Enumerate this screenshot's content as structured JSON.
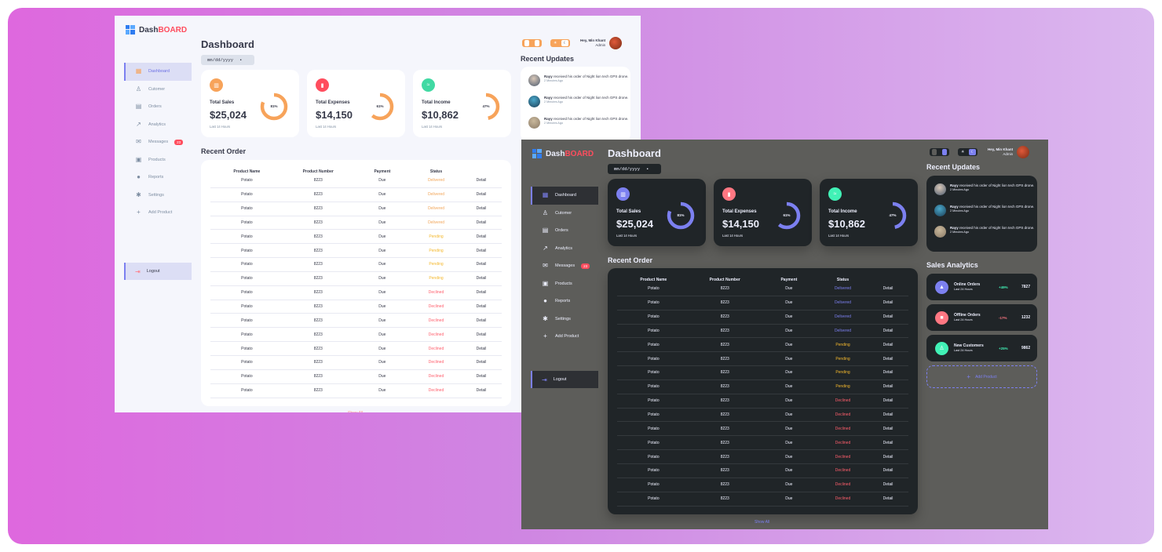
{
  "brand": {
    "part1": "Dash",
    "part2": "BOARD"
  },
  "nav": [
    {
      "label": "Dashboard",
      "icon": "grid-icon"
    },
    {
      "label": "Cutomer",
      "icon": "person-icon"
    },
    {
      "label": "Orders",
      "icon": "receipt-icon"
    },
    {
      "label": "Analytics",
      "icon": "trend-icon"
    },
    {
      "label": "Messages",
      "icon": "mail-icon",
      "badge": "23"
    },
    {
      "label": "Products",
      "icon": "inventory-icon"
    },
    {
      "label": "Reports",
      "icon": "report-icon"
    },
    {
      "label": "Settings",
      "icon": "gear-icon"
    },
    {
      "label": "Add Product",
      "icon": "plus-icon"
    }
  ],
  "logout": "Logout",
  "title": "Dashboard",
  "date_placeholder": "mm/dd/yyyy",
  "cards": [
    {
      "title": "Total Sales",
      "value": "$25,024",
      "sub": "Last 14 Hours",
      "percent": "81%",
      "fraction": 0.81,
      "icon": "analytics-icon",
      "color_light": "#f7a35a",
      "color_dark": "#7c80f0"
    },
    {
      "title": "Total Expenses",
      "value": "$14,150",
      "sub": "Last 14 Hours",
      "percent": "61%",
      "fraction": 0.61,
      "icon": "bar-chart-icon",
      "color_light": "#ff4d5e",
      "color_dark": "#ff7782"
    },
    {
      "title": "Total Income",
      "value": "$10,862",
      "sub": "Last 14 Hours",
      "percent": "47%",
      "fraction": 0.47,
      "icon": "stacked-line-icon",
      "color_light": "#41d9a3",
      "color_dark": "#41f1b6"
    }
  ],
  "ring_color_light": "#f7a35a",
  "ring_color_dark": "#7c80f0",
  "recent_order_title": "Recent Order",
  "table_headers": [
    "Product Name",
    "Product Number",
    "Payment",
    "Status"
  ],
  "rows": [
    {
      "name": "Potato",
      "number": "8223",
      "payment": "Due",
      "status": "Delivered",
      "action": "Detail"
    },
    {
      "name": "Potato",
      "number": "8223",
      "payment": "Due",
      "status": "Delivered",
      "action": "Detail"
    },
    {
      "name": "Potato",
      "number": "8223",
      "payment": "Due",
      "status": "Delivered",
      "action": "Detail"
    },
    {
      "name": "Potato",
      "number": "8223",
      "payment": "Due",
      "status": "Delivered",
      "action": "Detail"
    },
    {
      "name": "Potato",
      "number": "8223",
      "payment": "Due",
      "status": "Pending",
      "action": "Detail"
    },
    {
      "name": "Potato",
      "number": "8223",
      "payment": "Due",
      "status": "Pending",
      "action": "Detail"
    },
    {
      "name": "Potato",
      "number": "8223",
      "payment": "Due",
      "status": "Pending",
      "action": "Detail"
    },
    {
      "name": "Potato",
      "number": "8223",
      "payment": "Due",
      "status": "Pending",
      "action": "Detail"
    },
    {
      "name": "Potato",
      "number": "8223",
      "payment": "Due",
      "status": "Declined",
      "action": "Detail"
    },
    {
      "name": "Potato",
      "number": "8223",
      "payment": "Due",
      "status": "Declined",
      "action": "Detail"
    },
    {
      "name": "Potato",
      "number": "8223",
      "payment": "Due",
      "status": "Declined",
      "action": "Detail"
    },
    {
      "name": "Potato",
      "number": "8223",
      "payment": "Due",
      "status": "Declined",
      "action": "Detail"
    },
    {
      "name": "Potato",
      "number": "8223",
      "payment": "Due",
      "status": "Declined",
      "action": "Detail"
    },
    {
      "name": "Potato",
      "number": "8223",
      "payment": "Due",
      "status": "Declined",
      "action": "Detail"
    },
    {
      "name": "Potato",
      "number": "8223",
      "payment": "Due",
      "status": "Declined",
      "action": "Detail"
    },
    {
      "name": "Potato",
      "number": "8223",
      "payment": "Due",
      "status": "Declined",
      "action": "Detail"
    }
  ],
  "show_all": "Show All",
  "updates_title": "Recent Updates",
  "updates": [
    {
      "name": "Rayy",
      "text": "received his order of Night lion tech GPS drone.",
      "ago": "2 Minutes Ago"
    },
    {
      "name": "Rayy",
      "text": "received his order of Night lion tech GPS drone.",
      "ago": "2 Minutes Ago"
    },
    {
      "name": "Rayy",
      "text": "received his order of Night lion tech GPS drone.",
      "ago": "2 Minutes Ago"
    }
  ],
  "greeting": {
    "hey": "Hey,",
    "name": "Min Khant",
    "role": "Admin"
  },
  "analytics_title": "Sales Analytics",
  "analytics": [
    {
      "title": "Online Orders",
      "sub": "Last 24 Hours",
      "change": "+49%",
      "value": "7827",
      "icon": "cart-icon",
      "color": "#7c80f0",
      "change_color": "#41f1b6"
    },
    {
      "title": "Offline Orders",
      "sub": "Last 24 Hours",
      "change": "-17%",
      "value": "1232",
      "icon": "bag-icon",
      "color": "#ff7782",
      "change_color": "#ff7782"
    },
    {
      "title": "New Customers",
      "sub": "Last 24 Hours",
      "change": "+25%",
      "value": "9862",
      "icon": "person-icon",
      "color": "#41f1b6",
      "change_color": "#41f1b6"
    }
  ],
  "add_product": "Add Product"
}
